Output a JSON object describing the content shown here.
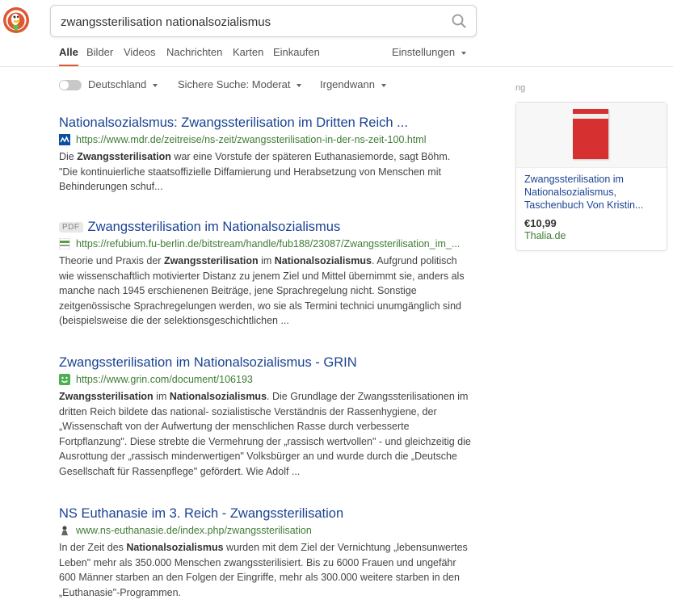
{
  "search": {
    "query": "zwangssterilisation nationalsozialismus"
  },
  "tabs": [
    {
      "label": "Alle",
      "active": true
    },
    {
      "label": "Bilder"
    },
    {
      "label": "Videos"
    },
    {
      "label": "Nachrichten"
    },
    {
      "label": "Karten"
    },
    {
      "label": "Einkaufen"
    }
  ],
  "settings_label": "Einstellungen",
  "filters": {
    "region": "Deutschland",
    "safe_search": "Sichere Suche: Moderat",
    "time": "Irgendwann"
  },
  "results": [
    {
      "title": "Nationalsozialsmus: Zwangssterilisation im Dritten Reich ...",
      "url": "https://www.mdr.de/zeitreise/ns-zeit/zwangssterilisation-in-der-ns-zeit-100.html",
      "favicon": "mdr-icon",
      "snippet": [
        {
          "t": "Die "
        },
        {
          "t": "Zwangssterilisation",
          "b": true
        },
        {
          "t": " war eine Vorstufe der späteren Euthanasiemorde, sagt Böhm. \"Die kontinuierliche staatsoffizielle Diffamierung und Herabsetzung von Menschen mit Behinderungen schuf..."
        }
      ]
    },
    {
      "title": "Zwangssterilisation im Nationalsozialismus",
      "badge": "PDF",
      "url": "https://refubium.fu-berlin.de/bitstream/handle/fub188/23087/Zwangssterilisation_im_...",
      "favicon": "refubium-icon",
      "snippet": [
        {
          "t": "Theorie und Praxis der "
        },
        {
          "t": "Zwangssterilisation",
          "b": true
        },
        {
          "t": " im "
        },
        {
          "t": "Nationalsozialismus",
          "b": true
        },
        {
          "t": ". Aufgrund politisch wie wissenschaftlich motivierter Distanz zu jenem Ziel und Mittel übernimmt sie, anders als manche nach 1945 erschienenen Beiträge, jene Sprachregelung nicht. Sonstige zeitgenössische Sprachregelungen werden, wo sie als Termini technici unumgänglich sind (beispielsweise die der selektionsgeschichtlichen ..."
        }
      ]
    },
    {
      "title": "Zwangssterilisation im Nationalsozialismus - GRIN",
      "url": "https://www.grin.com/document/106193",
      "favicon": "grin-icon",
      "snippet": [
        {
          "t": "Zwangssterilisation",
          "b": true
        },
        {
          "t": " im "
        },
        {
          "t": "Nationalsozialismus",
          "b": true
        },
        {
          "t": ". Die Grundlage der Zwangssterilisationen im dritten Reich bildete das national- sozialistische Verständnis der Rassenhygiene, der „Wissenschaft von der Aufwertung der menschlichen Rasse durch verbesserte Fortpflanzung\". Diese strebte die Vermehrung der „rassisch wertvollen\" - und gleichzeitig die Ausrottung der „rassisch minderwertigen\" Volksbürger an und wurde durch die „Deutsche Gesellschaft für Rassenpflege\" gefördert. Wie Adolf ..."
        }
      ]
    },
    {
      "title": "NS Euthanasie im 3. Reich - Zwangssterilisation",
      "url": "www.ns-euthanasie.de/index.php/zwangssterilisation",
      "favicon": "ns-euthanasie-icon",
      "snippet": [
        {
          "t": "In der Zeit des "
        },
        {
          "t": "Nationalsozialismus",
          "b": true
        },
        {
          "t": " wurden mit dem Ziel der Vernichtung „lebensunwertes Leben\" mehr als 350.000 Menschen zwangssterilisiert. Bis zu 6000 Frauen und ungefähr 600 Männer starben an den Folgen der Eingriffe, mehr als 300.000 weitere starben in den „Euthanasie\"-Programmen."
        }
      ]
    }
  ],
  "sidebar": {
    "label": "ng",
    "product": {
      "title": "Zwangssterilisation im Nationalsozialismus, Taschenbuch Von Kristin...",
      "price": "€10,99",
      "store": "Thalia.de"
    }
  },
  "colors": {
    "link": "#1a4393",
    "url": "#3f7d35",
    "accent": "#de5833"
  }
}
